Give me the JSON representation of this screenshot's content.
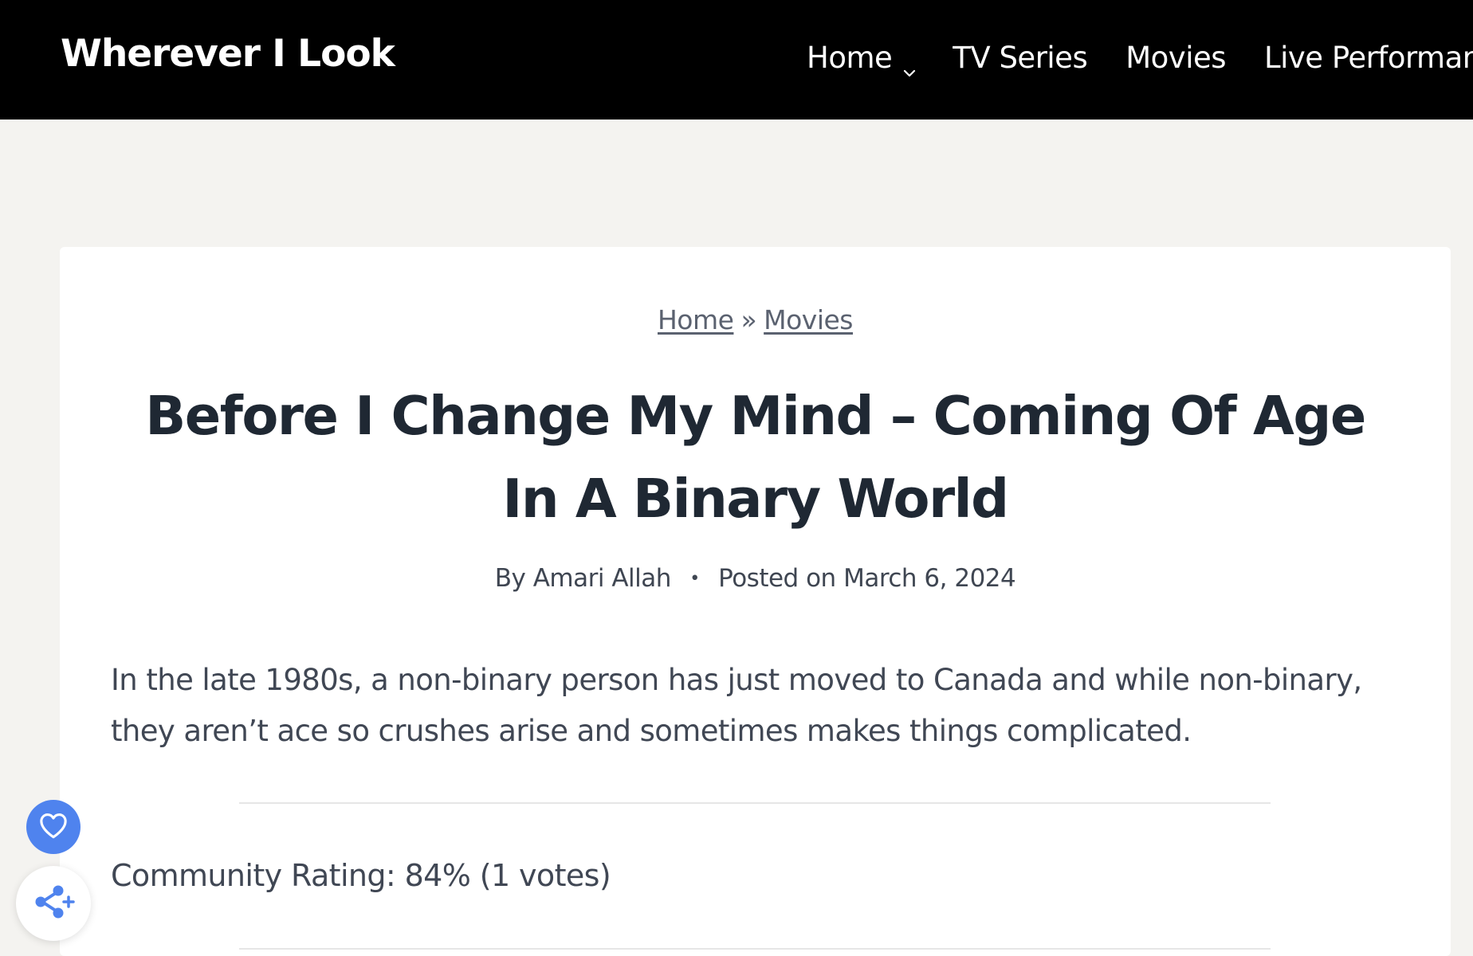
{
  "header": {
    "site_title": "Wherever I Look",
    "nav": [
      {
        "label": "Home",
        "has_dropdown": true
      },
      {
        "label": "TV Series",
        "has_dropdown": false
      },
      {
        "label": "Movies",
        "has_dropdown": false
      },
      {
        "label": "Live Performances",
        "has_dropdown": false
      }
    ],
    "chevron_icon": "chevron-down-icon"
  },
  "breadcrumb": {
    "items": [
      "Home",
      "Movies"
    ],
    "separator": "»"
  },
  "post": {
    "title": "Before I Change My Mind – Coming Of Age In A Binary World",
    "author_prefix": "By",
    "author": "Amari Allah",
    "meta_separator": "•",
    "posted_prefix": "Posted on",
    "date": "March 6, 2024",
    "excerpt": "In the late 1980s, a non-binary person has just moved to Canada and while non-binary, they aren’t ace so crushes arise and sometimes makes things complicated.",
    "rating": "Community Rating: 84% (1 votes)"
  },
  "floating": {
    "like_icon": "heart-icon",
    "share_icon": "share-plus-icon"
  },
  "colors": {
    "header_bg": "#000000",
    "page_bg": "#f4f3f0",
    "card_bg": "#ffffff",
    "title_text": "#1f2833",
    "accent_blue": "#4f83ee"
  }
}
